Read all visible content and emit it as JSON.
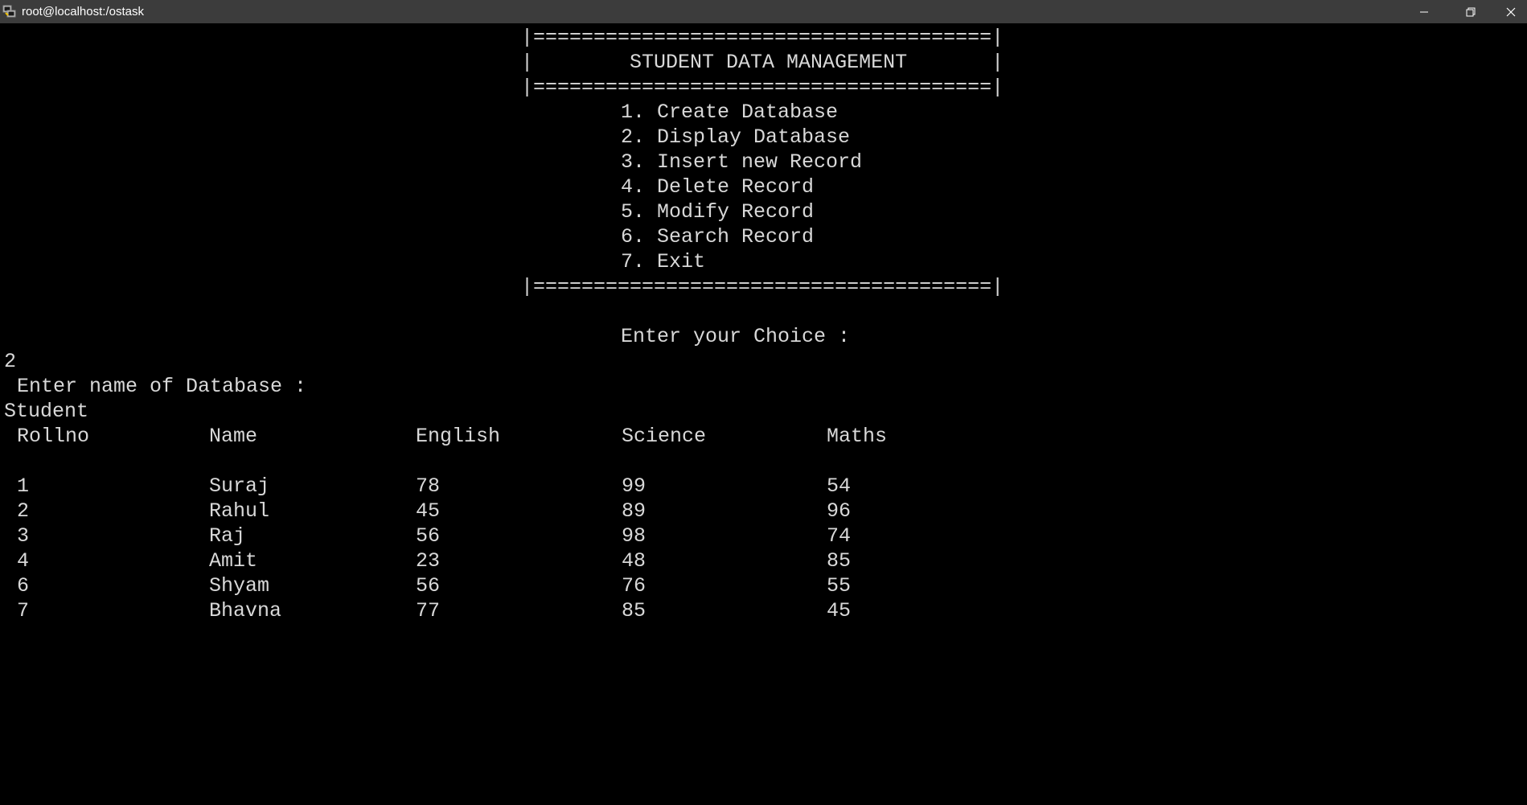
{
  "window": {
    "title": "root@localhost:/ostask"
  },
  "menu": {
    "border_top": "|======================================|",
    "heading": "|        STUDENT DATA MANAGEMENT       |",
    "border_mid": "|======================================|",
    "items": [
      "1. Create Database",
      "2. Display Database",
      "3. Insert new Record",
      "4. Delete Record",
      "5. Modify Record",
      "6. Search Record",
      "7. Exit"
    ],
    "border_bottom": "|======================================|"
  },
  "session": {
    "choice_prompt": "Enter your Choice :",
    "choice_input": "2",
    "db_prompt": "Enter name of Database :",
    "db_input": "Student"
  },
  "table": {
    "headers": [
      "Rollno",
      "Name",
      "English",
      "Science",
      "Maths"
    ],
    "rows": [
      [
        "1",
        "Suraj",
        "78",
        "99",
        "54"
      ],
      [
        "2",
        "Rahul",
        "45",
        "89",
        "96"
      ],
      [
        "3",
        "Raj",
        "56",
        "98",
        "74"
      ],
      [
        "4",
        "Amit",
        "23",
        "48",
        "85"
      ],
      [
        "6",
        "Shyam",
        "56",
        "76",
        "55"
      ],
      [
        "7",
        "Bhavna",
        "77",
        "85",
        "45"
      ]
    ]
  },
  "colors": {
    "titlebar": "#3c3c3c",
    "background": "#000000",
    "text": "#d8d8d8"
  }
}
